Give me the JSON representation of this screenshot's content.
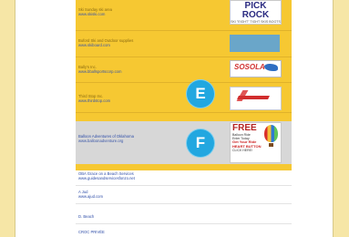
{
  "entries": [
    {
      "line1": "Ski Sunday ski area",
      "line2": "www.skiski.com"
    },
    {
      "line1": "Buford Ski and Outdoor supplies",
      "line2": "www.skiboard.com"
    },
    {
      "line1": "Bally's Inc.",
      "line2": "www.bballsportscorp.com"
    },
    {
      "line1": "Third Stop Inc.",
      "line2": "www.thirdstop.com"
    },
    {
      "line1": "Balloon Adventures of Oklahoma",
      "line2": "www.balloonadventure.org"
    }
  ],
  "lower_entries": [
    {
      "line1": "OBA Grace on a Beach Services",
      "line2": "www.guidesandservicesfonzo.net"
    },
    {
      "line1": "A Jud",
      "line2": "www.ajud.com"
    },
    {
      "line1": "D. Beach",
      "line2": ""
    },
    {
      "line1": "CROC PRIVÉE",
      "line2": ""
    }
  ],
  "ads": {
    "ad1_big": "PICK ROCK",
    "ad1_small": "SKI  \"EIGHT\"  TIGHT  SKIS BOOTS",
    "ad2_text": "",
    "ad3_logo": "SOSOLA",
    "ad5_free": "FREE",
    "ad5_txt1": "Balloon Ride",
    "ad5_txt2": "Enter Today",
    "ad5_red1": "Get Your Ride",
    "ad5_red2": "HEART BUTTON",
    "ad5_txt3": "CLICK HERE!"
  },
  "markers": {
    "e": "E",
    "f": "F"
  },
  "colors": {
    "panel": "#f6c832",
    "gray": "#d7d7d7",
    "badge": "#22a7e0"
  }
}
